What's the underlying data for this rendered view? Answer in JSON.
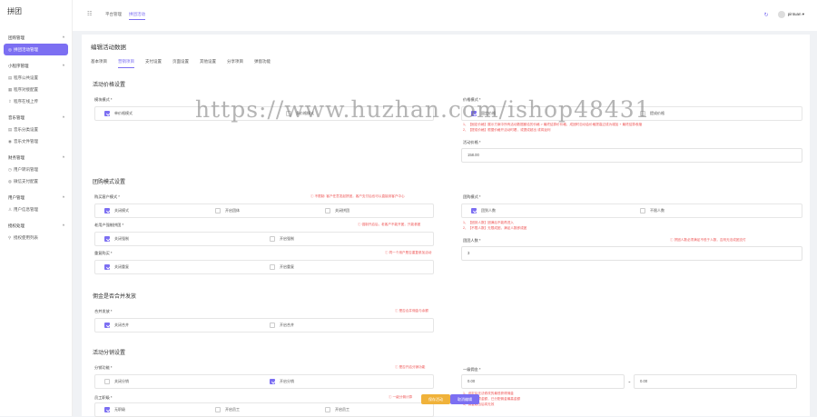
{
  "sidebar": {
    "logo": "拼团",
    "groups": [
      {
        "title": "团购管理",
        "items": [
          "拼团活动管理"
        ]
      },
      {
        "title": "小程序管理",
        "items": [
          "程序公共设置",
          "程序对接配置",
          "程序在线上传"
        ]
      },
      {
        "title": "音乐管理",
        "items": [
          "音乐分类设置",
          "音乐文件管理"
        ]
      },
      {
        "title": "财务管理",
        "items": [
          "用户转讯管理",
          "微信支付配置"
        ]
      },
      {
        "title": "用户管理",
        "items": [
          "用户信息管理"
        ]
      },
      {
        "title": "授权处理",
        "items": [
          "授权使用列表"
        ]
      }
    ]
  },
  "topbar": {
    "crumbs": [
      "平台管理",
      "拼团活动"
    ],
    "username": "pintuan"
  },
  "main": {
    "title": "编辑活动数据",
    "tabs": [
      "基本项目",
      "营销项目",
      "支付设置",
      "页面设置",
      "其他设置",
      "分享项目",
      "弹窗功能"
    ],
    "price_section": {
      "title": "活动价格设置",
      "mode_label": "模块模式 *",
      "mode_options": [
        "单价格模式",
        "多价格模式"
      ],
      "price_mode_label": "价格模式 *",
      "price_mode_options": [
        "固定价格",
        "提成价格"
      ],
      "notes": [
        "1、【固定价格】展示方案中所有活动数据都给的价格 > 最终结算价价格，成团时自动会价格提高过成为增加 + 最终结算收缩",
        "2、【提成价格】根据价格开活动时看，或提成超出 或将返利"
      ],
      "price_label": "活动价格 *",
      "price_value": "158.00"
    },
    "group_section": {
      "title": "团购模式设置",
      "mode_label": "购买客户模式 *",
      "mode_hint": "ⓘ 不限制: 客户任意发起拼团，客户支付后也可以直接到客户中心",
      "mode_options": [
        "关闭模式",
        "开启团体",
        "关闭拼团"
      ],
      "force_label": "老用户强制拼团 *",
      "force_hint": "ⓘ 强制开启后，老客户不能开团，只能参团",
      "force_options": [
        "关闭强制",
        "开启强制"
      ],
      "repeat_label": "重复购买 *",
      "repeat_hint": "ⓘ 同一个用户是否重复参加活动",
      "repeat_options": [
        "关闭重复",
        "开启重复"
      ],
      "tuan_mode_label": "团购模式 *",
      "tuan_mode_options": [
        "团到人数",
        "不限人数"
      ],
      "tuan_notes": [
        "1、【团到人数】团满后不能再进入",
        "2、【不限人数】无限成团，满足人数即成团"
      ],
      "count_label": "团团人数 *",
      "count_hint": "ⓘ 拼团人数必须满足不低于人数，否则无法成团支付",
      "count_value": "3"
    },
    "merge_section": {
      "title": "佣金是否合并发放",
      "label": "合并发放 *",
      "hint": "ⓘ 是否合并佣金与余额",
      "options": [
        "关闭合并",
        "开启合并"
      ]
    },
    "dist_section": {
      "title": "活动分销设置",
      "label": "分销功能 *",
      "hint": "ⓘ 是否开启分销功能",
      "options": [
        "关闭分销",
        "开启分销"
      ],
      "staff_label": "员工职级 *",
      "staff_hint": "ⓘ 一级分佣计算",
      "staff_options": [
        "无职级",
        "开启员工",
        "开启员工"
      ],
      "rate_label": "一级佣金 *",
      "rate_values": [
        "0.00",
        "0.00"
      ],
      "rate_sep": "~",
      "rate_notes": [
        "1、设定后无法修改的最低获得佣金",
        "2、最低必须金额，已分配佣金最高金额",
        "3、佣金超出后将无效"
      ]
    },
    "buttons": {
      "save": "保存活动",
      "cancel": "取消编辑"
    }
  },
  "watermark": "https://www.huzhan.com/ishop48431",
  "colors": {
    "accent": "#7c6ff2",
    "hint": "#e55555",
    "save": "#f0b23a"
  }
}
